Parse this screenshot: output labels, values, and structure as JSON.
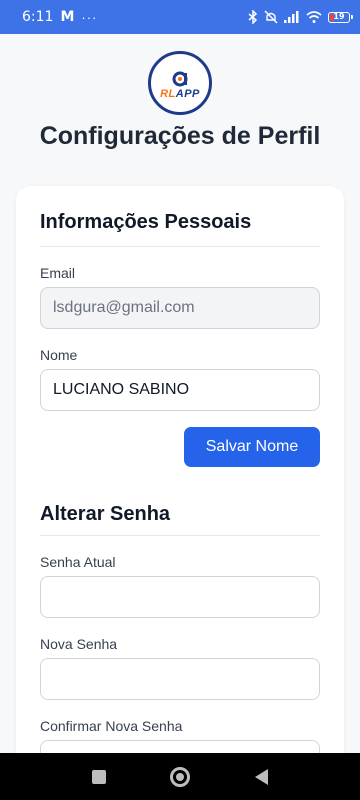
{
  "status_bar": {
    "time": "6:11",
    "mail_icon": "M",
    "more": "···",
    "battery_level": "19",
    "battery_fraction": 0.19
  },
  "logo": {
    "text_part1": "RL",
    "text_part2": "APP"
  },
  "page": {
    "title": "Configurações de Perfil"
  },
  "personal_info": {
    "title": "Informações Pessoais",
    "email_label": "Email",
    "email_value": "lsdgura@gmail.com",
    "name_label": "Nome",
    "name_value": "LUCIANO SABINO",
    "save_button": "Salvar Nome"
  },
  "change_password": {
    "title": "Alterar Senha",
    "current_label": "Senha Atual",
    "current_value": "",
    "new_label": "Nova Senha",
    "new_value": "",
    "confirm_label": "Confirmar Nova Senha",
    "confirm_value": ""
  },
  "colors": {
    "status_bar": "#3d73e6",
    "primary_button": "#2563eb",
    "logo_ring": "#1e3a8a",
    "logo_accent": "#f97316"
  }
}
